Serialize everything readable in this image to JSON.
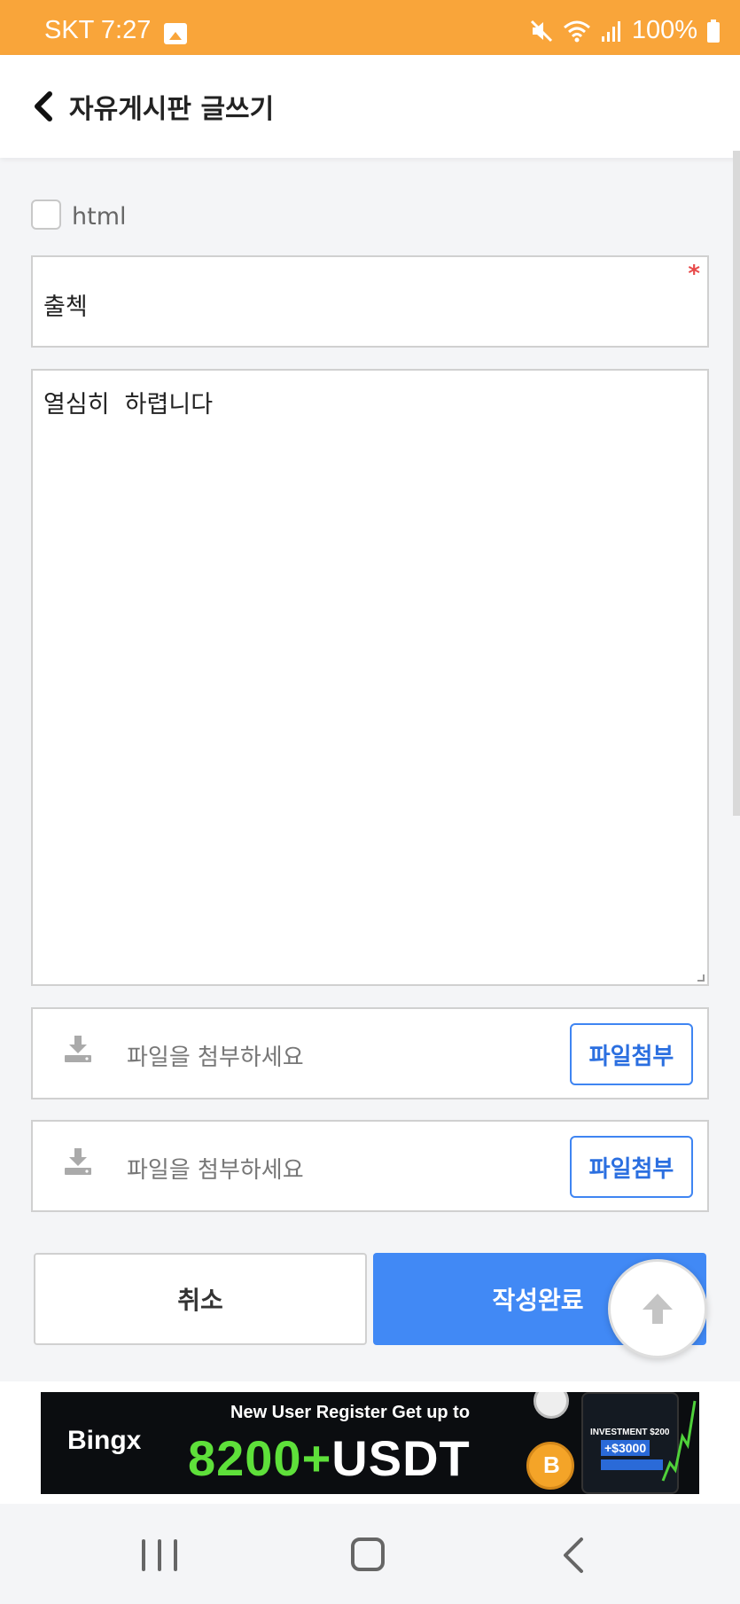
{
  "status_bar": {
    "carrier_time": "SKT 7:27",
    "battery": "100%",
    "icons": [
      "gallery-icon",
      "mute-icon",
      "wifi-icon",
      "signal-icon",
      "battery-icon"
    ]
  },
  "header": {
    "title": "자유게시판 글쓰기",
    "back_icon": "chevron-left-icon"
  },
  "form": {
    "html_option_label": "html",
    "html_checked": false,
    "title_value": "출첵",
    "required_mark": "*",
    "content_value": "열심히  하렵니다",
    "attachments": [
      {
        "placeholder": "파일을 첨부하세요",
        "button_label": "파일첨부"
      },
      {
        "placeholder": "파일을 첨부하세요",
        "button_label": "파일첨부"
      }
    ],
    "cancel_label": "취소",
    "submit_label": "작성완료"
  },
  "ad": {
    "brand": "Bingx",
    "tagline": "New User Register Get up to",
    "promo_number": "8200+",
    "promo_unit": "USDT",
    "phone_line1": "INVESTMENT $200",
    "phone_line2": "+$3000"
  },
  "colors": {
    "status_bar": "#f9a53a",
    "primary": "#4189f5",
    "required": "#e84a4a",
    "ad_green": "#5ee03a"
  }
}
